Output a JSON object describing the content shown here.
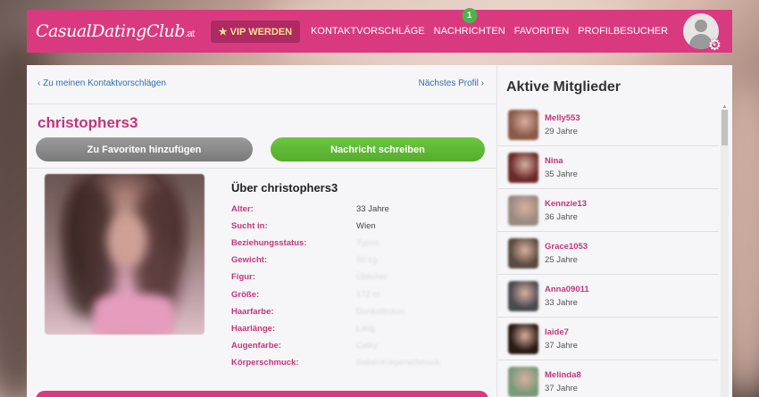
{
  "header": {
    "logo_main": "CasualDatingClub",
    "logo_tld": ".at",
    "vip_label": "★ VIP WERDEN",
    "nav": [
      {
        "label": "KONTAKTVORSCHLÄGE"
      },
      {
        "label": "NACHRICHTEN",
        "badge": "1"
      },
      {
        "label": "FAVORITEN"
      },
      {
        "label": "PROFILBESUCHER"
      }
    ],
    "avatar_icon": "user-avatar-icon",
    "settings_icon": "gear-icon"
  },
  "profile_nav": {
    "back": "‹ Zu meinen Kontaktvorschlägen",
    "next": "Nächstes Profil ›"
  },
  "profile": {
    "username": "christophers3",
    "fav_button": "Zu Favoriten hinzufügen",
    "message_button": "Nachricht schreiben",
    "about_title": "Über christophers3",
    "rows": [
      {
        "key": "Alter:",
        "value": "33 Jahre",
        "blurred": false
      },
      {
        "key": "Sucht in:",
        "value": "Wien",
        "blurred": false
      },
      {
        "key": "Beziehungsstatus:",
        "value": "Typos",
        "blurred": true
      },
      {
        "key": "Gewicht:",
        "value": "60 kg",
        "blurred": true
      },
      {
        "key": "Figur:",
        "value": "Üblicher",
        "blurred": true
      },
      {
        "key": "Größe:",
        "value": "172 m",
        "blurred": true
      },
      {
        "key": "Haarfarbe:",
        "value": "Dunkelbraun",
        "blurred": true
      },
      {
        "key": "Haarlänge:",
        "value": "Lang",
        "blurred": true
      },
      {
        "key": "Augenfarbe:",
        "value": "Caiky",
        "blurred": true
      },
      {
        "key": "Körperschmuck:",
        "value": "Nabel-Körperschmuck",
        "blurred": true
      }
    ]
  },
  "sidebar": {
    "title": "Aktive Mitglieder",
    "members": [
      {
        "name": "Melly553",
        "age": "29 Jahre",
        "color": "#8a5a4a"
      },
      {
        "name": "Nina",
        "age": "35 Jahre",
        "color": "#6b2a2a"
      },
      {
        "name": "Kennzie13",
        "age": "36 Jahre",
        "color": "#9a8a80"
      },
      {
        "name": "Grace1053",
        "age": "25 Jahre",
        "color": "#5a4a40"
      },
      {
        "name": "Anna09011",
        "age": "33 Jahre",
        "color": "#4a4a52"
      },
      {
        "name": "laide7",
        "age": "37 Jahre",
        "color": "#2a1a14"
      },
      {
        "name": "Melinda8",
        "age": "37 Jahre",
        "color": "#7a9a7a"
      }
    ]
  }
}
